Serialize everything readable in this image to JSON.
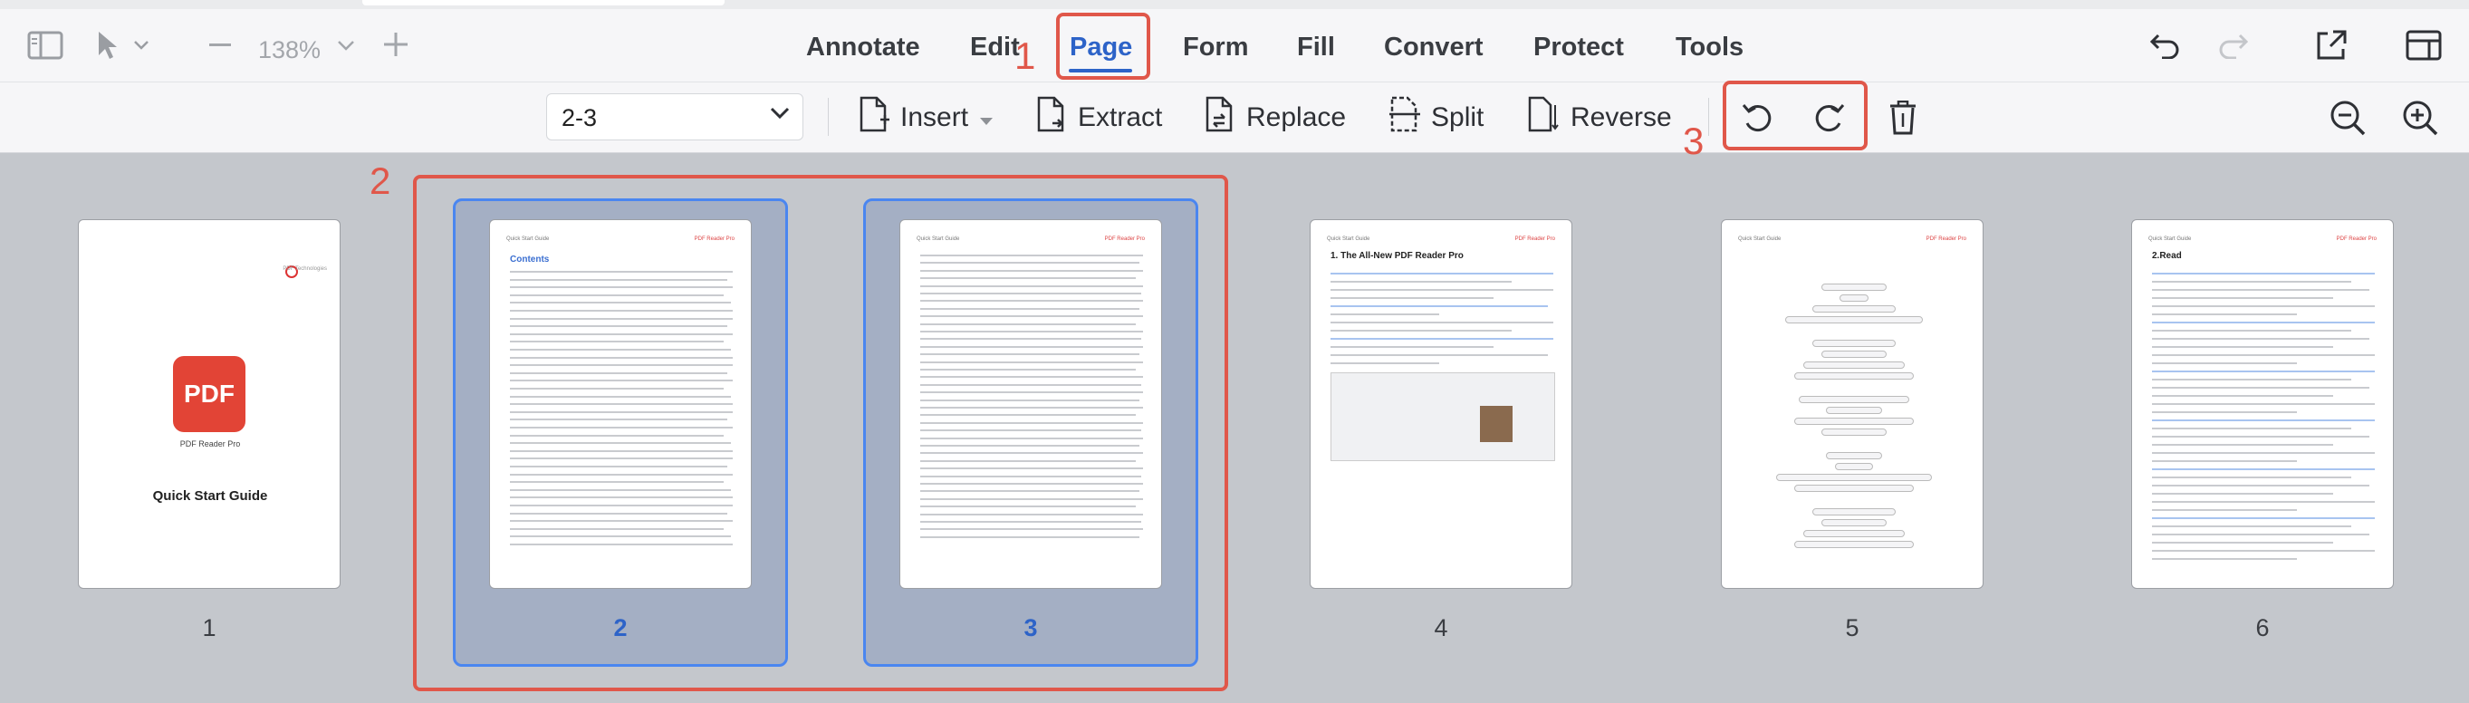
{
  "window": {
    "zoom": "138%"
  },
  "menu": {
    "items": [
      "Annotate",
      "Edit",
      "Page",
      "Form",
      "Fill",
      "Convert",
      "Protect",
      "Tools"
    ],
    "active": "Page"
  },
  "toolbar": {
    "page_range_value": "2-3",
    "insert_label": "Insert",
    "extract_label": "Extract",
    "replace_label": "Replace",
    "split_label": "Split",
    "reverse_label": "Reverse"
  },
  "annotations": {
    "n1": "1",
    "n2": "2",
    "n3": "3"
  },
  "pages": [
    {
      "number": "1",
      "selected": false
    },
    {
      "number": "2",
      "selected": true
    },
    {
      "number": "3",
      "selected": true
    },
    {
      "number": "4",
      "selected": false
    },
    {
      "number": "5",
      "selected": false
    },
    {
      "number": "6",
      "selected": false
    }
  ],
  "page_content": {
    "p1_brand": "PDF Reader Pro",
    "p1_logo_text": "PDF",
    "p1_title": "Quick Start Guide",
    "p_header": "Quick Start Guide",
    "p2_heading": "Contents",
    "p4_heading": "1. The All-New PDF Reader Pro",
    "p6_heading": "2.Read"
  },
  "colors": {
    "accent": "#2d63c8",
    "annotation": "#e0574a",
    "selection_border": "#4a86f0"
  }
}
